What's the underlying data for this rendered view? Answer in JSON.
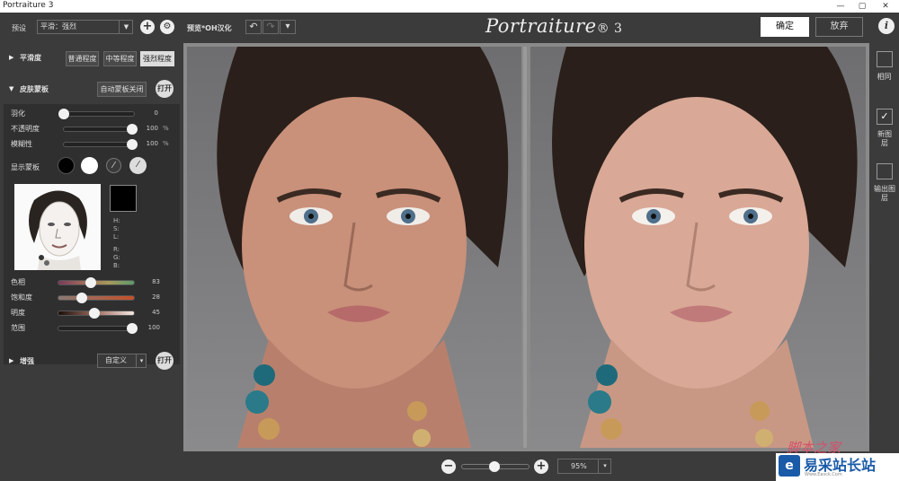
{
  "window": {
    "title": "Portraiture 3",
    "minimize": "—",
    "maximize": "▢",
    "close": "✕"
  },
  "toolbar": {
    "preset_label": "预设",
    "preset_value": "平滑：强烈",
    "preview_label": "预览*OH汉化",
    "undo_icon": "↶",
    "redo_icon": "↷",
    "more_icon": "▾",
    "logo": "Portraiture",
    "logo_version": "® 3",
    "ok": "确定",
    "cancel": "放弃",
    "info": "i"
  },
  "smoothing": {
    "title": "平滑度",
    "options": [
      "普通程度",
      "中等程度",
      "强烈程度"
    ],
    "selected": 2
  },
  "skin_mask": {
    "title": "皮肤蒙板",
    "auto_button": "自动蒙板关闭",
    "toggle": "打开",
    "sliders": [
      {
        "label": "羽化",
        "value": "0",
        "unit": "",
        "fraction": 0
      },
      {
        "label": "不透明度",
        "value": "100",
        "unit": "%",
        "fraction": 1
      },
      {
        "label": "模糊性",
        "value": "100",
        "unit": "%",
        "fraction": 1
      }
    ],
    "show_mask_label": "显示蒙板",
    "hsl_labels": [
      "H:",
      "S:",
      "L:"
    ],
    "rgb_labels": [
      "R:",
      "G:",
      "B:"
    ],
    "color_sliders": [
      {
        "label": "色相",
        "value": "83",
        "fraction": 0.44
      },
      {
        "label": "饱和度",
        "value": "28",
        "fraction": 0.3
      },
      {
        "label": "明度",
        "value": "45",
        "fraction": 0.48
      },
      {
        "label": "范围",
        "value": "100",
        "fraction": 1
      }
    ]
  },
  "enhance": {
    "title": "增强",
    "dropdown": "自定义",
    "toggle": "打开"
  },
  "side": {
    "items": [
      {
        "label": "相同",
        "checked": false
      },
      {
        "label": "新图层",
        "checked": true
      },
      {
        "label": "输出图层",
        "checked": false
      }
    ]
  },
  "zoom": {
    "value": "95%",
    "minus": "−",
    "plus": "+",
    "fraction": 0.48
  },
  "watermark": {
    "top": "脚本之家",
    "main": "易采站长站",
    "sub": "Www.Easck.Com"
  },
  "colors": {
    "accent": "#ffffff",
    "bg": "#3b3b3b",
    "panel": "#2f2f2f"
  }
}
